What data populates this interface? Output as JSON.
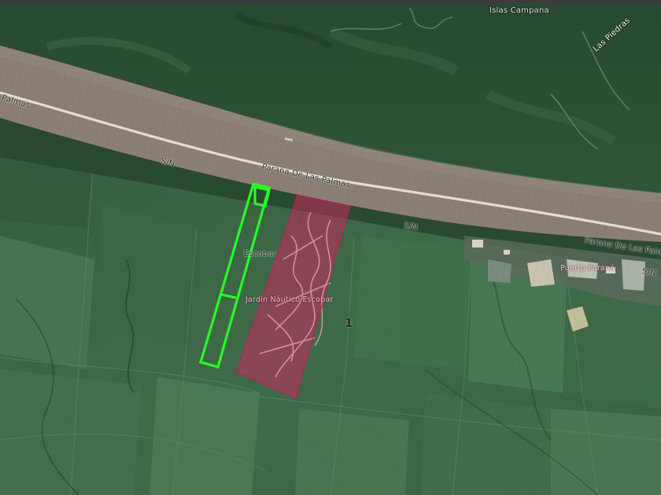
{
  "map": {
    "labels": {
      "islas_campana": "Islas Campana",
      "las_piedras": "Las Piedras",
      "palmas_left": "Palmas",
      "sn_left": "S/N",
      "parana_mid": "Parana De Las Palmas",
      "sn_mid": "S/N",
      "parana_right": "Parana De Las Palm",
      "sn_right": "S/N",
      "escobar": "Escobar",
      "jardin_nautico": "Jardin Náutico Escobar",
      "puerto_parana": "Puerto Paraná",
      "parcel_number": "1"
    },
    "colors": {
      "river": "#8a7c72",
      "road": "#e6e2d8",
      "vegetation_dark": "#2d4d33",
      "field": "#3e6a47",
      "parcel_outline": "#27ff27",
      "development_fill": "#c8285c",
      "place_label_pink": "#f3b2c8"
    }
  }
}
